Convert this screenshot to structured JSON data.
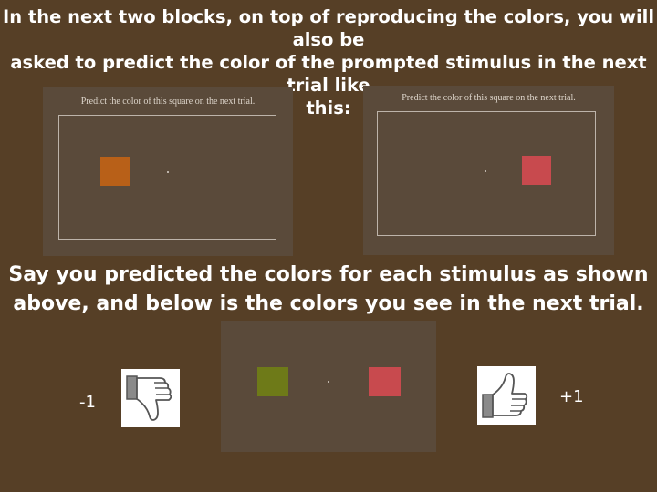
{
  "instructions": {
    "line1": "In the next two blocks, on top of reproducing the colors, you will also be",
    "line2": "asked to predict the color of the prompted stimulus in the next trial like",
    "line3": "this:"
  },
  "prediction_panels": [
    {
      "caption": "Predict the color of this square on the next trial.",
      "square_color": "#b86018"
    },
    {
      "caption": "Predict the color of this square on the next trial.",
      "square_color": "#c84a4e"
    }
  ],
  "explanation": {
    "line1": "Say you predicted the colors for each stimulus as shown",
    "line2": "above, and below is the colors you see in the next trial."
  },
  "next_trial": {
    "left_square_color": "#6e7a18",
    "right_square_color": "#c84a4e"
  },
  "feedback": {
    "negative_score": "-1",
    "positive_score": "+1",
    "negative_icon": "thumbs-down-icon",
    "positive_icon": "thumbs-up-icon"
  },
  "colors": {
    "background": "#563f26",
    "panel": "#5a4a3a",
    "text": "#ffffff"
  }
}
